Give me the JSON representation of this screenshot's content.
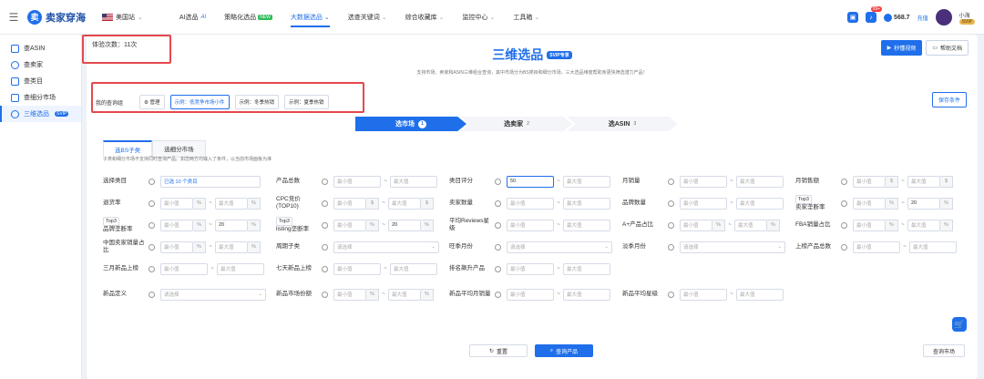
{
  "topbar": {
    "logo_text": "卖家穿海",
    "site": "美国站",
    "nav": [
      {
        "label": "AI选品",
        "sup": "AI"
      },
      {
        "label": "策略化选品",
        "badge": "NEW"
      },
      {
        "label": "大数据选品",
        "active": true
      },
      {
        "label": "选查关键词"
      },
      {
        "label": "综合收藏库"
      },
      {
        "label": "监控中心"
      },
      {
        "label": "工具箱"
      }
    ],
    "notif_count": "99+",
    "coins": "568.7",
    "recharge": "充值",
    "user_name": "小海",
    "user_badge": "SVIP"
  },
  "sidebar": {
    "items": [
      {
        "label": "查ASIN"
      },
      {
        "label": "查卖家"
      },
      {
        "label": "查类目"
      },
      {
        "label": "查细分市场"
      },
      {
        "label": "三维选品",
        "badge": "SVIP",
        "active": true
      }
    ]
  },
  "main": {
    "trial_text": "体验次数：11次",
    "title": "三维选品",
    "title_badge": "SVIP专享",
    "subtitle": "支持市场、卖家和ASIN三维组合查询，其中市场分为BS类目和细分市场，三大选品维度帮助亲更快筛选潜力产品！",
    "video_btn": "秒懂视频",
    "help_btn": "帮助文档",
    "query_group_label": "我的查询组",
    "manage_btn": "管理",
    "query_examples": [
      "示例：低竞争市场小件",
      "示例：冬季热销",
      "示例：夏季热销"
    ],
    "save_btn": "保存条件",
    "steps": [
      {
        "label": "选市场",
        "num": "1"
      },
      {
        "label": "选卖家",
        "num": "2"
      },
      {
        "label": "选ASIN",
        "num": "3"
      }
    ],
    "tabs": [
      "选BS子类",
      "选细分市场"
    ],
    "hint": "子类和细分市场不支持同时查询产品。如您两方均输入了条件，以当前市场面板为准",
    "min": "最小值",
    "max": "最大值",
    "please_select": "请选择",
    "fields": {
      "category": {
        "label": "选择类目",
        "value": "已选 10 个类目"
      },
      "product_count": {
        "label": "产品总数"
      },
      "category_rating": {
        "label": "类目评分",
        "min_value": "50"
      },
      "monthly_sales": {
        "label": "月销量"
      },
      "monthly_revenue": {
        "label": "月销售额",
        "unit": "$"
      },
      "return_rate": {
        "label": "退货率",
        "unit": "%"
      },
      "cpc": {
        "label": "CPC竞价(TOP10)",
        "unit": "$"
      },
      "seller_count": {
        "label": "卖家数量"
      },
      "brand_count": {
        "label": "品牌数量"
      },
      "top3_seller": {
        "label": "卖家垄断率",
        "prefix": "Top3",
        "max_value": "20",
        "unit": "%"
      },
      "top3_brand": {
        "label": "品牌垄断率",
        "prefix": "Top3",
        "max_value": "20",
        "unit": "%"
      },
      "top3_listing": {
        "label": "listing垄断率",
        "prefix": "Top3",
        "max_value": "20",
        "unit": "%"
      },
      "avg_reviews": {
        "label": "平均Reviews星级"
      },
      "aplus_ratio": {
        "label": "A+产品占比",
        "unit": "%"
      },
      "fba_ratio": {
        "label": "FBA销量占比",
        "unit": "%"
      },
      "cn_seller_ratio": {
        "label": "中国卖家销量占比",
        "unit": "%"
      },
      "cycle_subcat": {
        "label": "周期子类"
      },
      "peak_month": {
        "label": "旺季月份"
      },
      "off_month": {
        "label": "淡季月份"
      },
      "listed_total": {
        "label": "上榜产品总数"
      },
      "new_3m": {
        "label": "三月新品上榜"
      },
      "new_7d": {
        "label": "七天新品上榜"
      },
      "surge_products": {
        "label": "排名飙升产品"
      },
      "new_def": {
        "label": "新品定义"
      },
      "new_market_share": {
        "label": "新品市场份额",
        "unit": "%"
      },
      "new_avg_sales": {
        "label": "新品平均月销量"
      },
      "new_avg_rating": {
        "label": "新品平均星级"
      }
    },
    "reset_btn": "重置",
    "query_btn": "查询产品",
    "market_btn": "查询市场"
  }
}
